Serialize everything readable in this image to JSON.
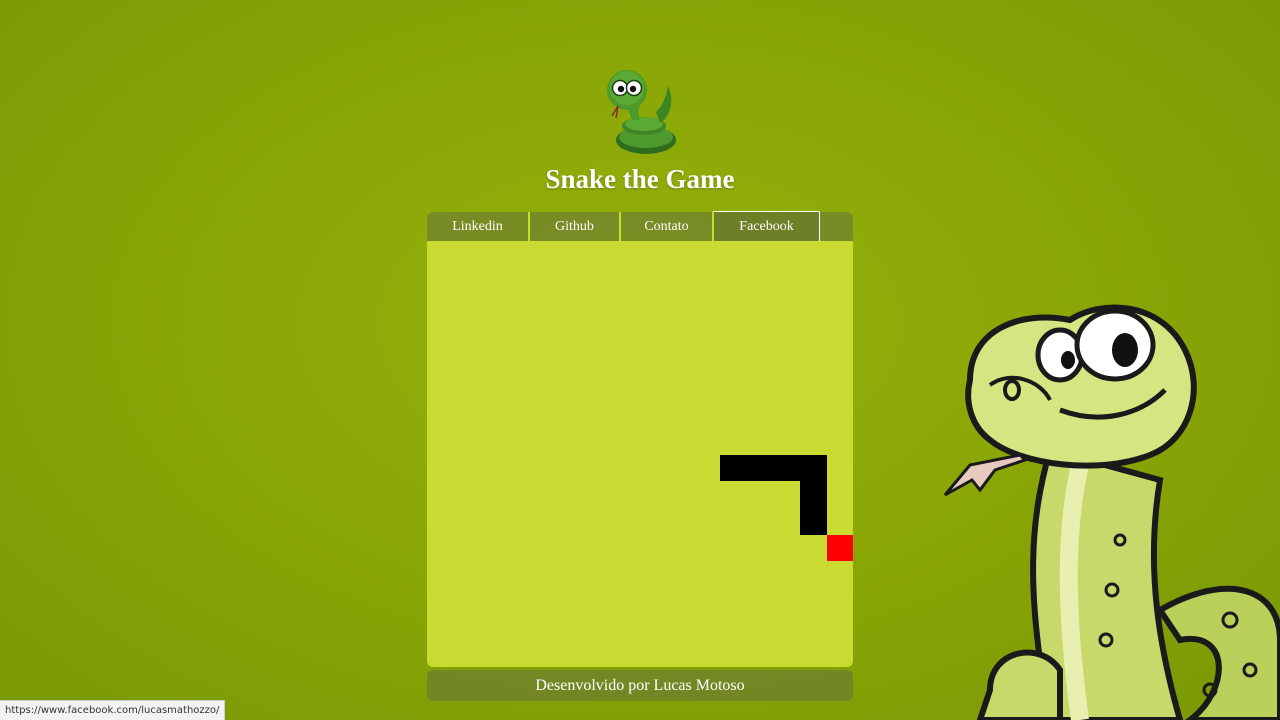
{
  "header": {
    "logo_icon": "snake-logo-icon",
    "title": "Snake the Game"
  },
  "nav": {
    "items": [
      {
        "label": "Linkedin"
      },
      {
        "label": "Github"
      },
      {
        "label": "Contato"
      },
      {
        "label": "Facebook"
      }
    ]
  },
  "game": {
    "snake_color": "#000000",
    "food_color": "#ff0000",
    "board_color": "#c9da32"
  },
  "footer": {
    "credit": "Desenvolvido por Lucas Motoso"
  },
  "status_bar": {
    "url": "https://www.facebook.com/lucasmathozzo/"
  },
  "decor": {
    "mascot_icon": "cartoon-snake-mascot-icon"
  }
}
